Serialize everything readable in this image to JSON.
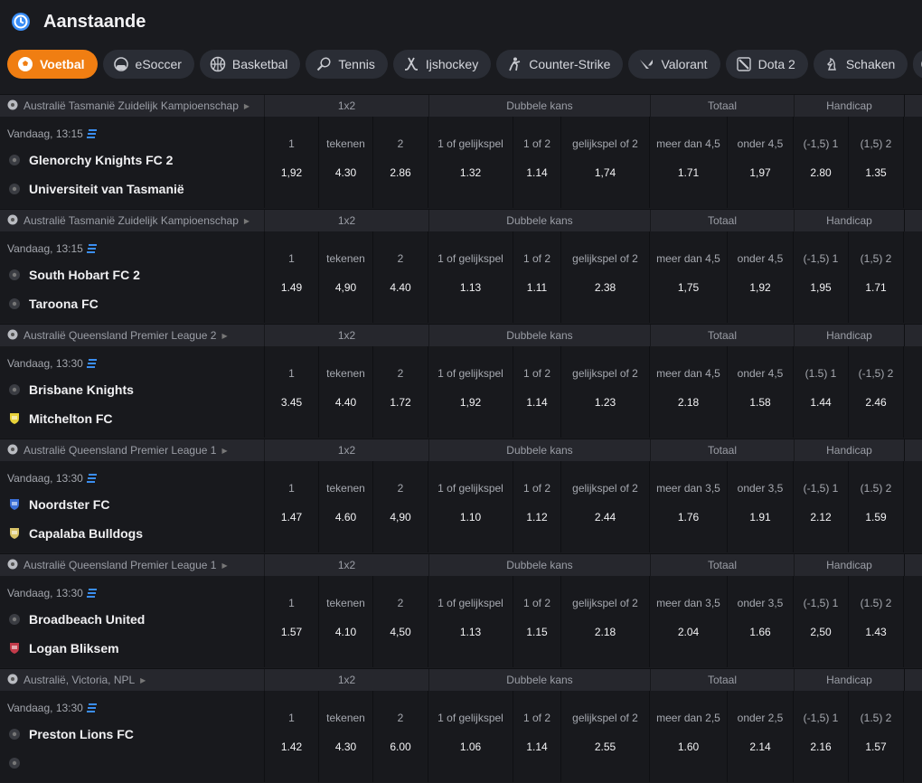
{
  "header": {
    "title": "Aanstaande"
  },
  "tabs": [
    {
      "label": "Voetbal",
      "icon": "soccer-ball-icon",
      "active": true
    },
    {
      "label": "eSoccer",
      "icon": "esoccer-icon"
    },
    {
      "label": "Basketbal",
      "icon": "basketball-icon"
    },
    {
      "label": "Tennis",
      "icon": "tennis-racket-icon"
    },
    {
      "label": "Ijshockey",
      "icon": "hockey-stick-icon"
    },
    {
      "label": "Counter-Strike",
      "icon": "counter-strike-icon"
    },
    {
      "label": "Valorant",
      "icon": "valorant-icon"
    },
    {
      "label": "Dota 2",
      "icon": "dota2-icon"
    },
    {
      "label": "Schaken",
      "icon": "chess-icon"
    },
    {
      "label": "",
      "icon": "more-sport-icon"
    }
  ],
  "groups": {
    "g1x2": "1x2",
    "dubbele": "Dubbele kans",
    "totaal": "Totaal",
    "handicap": "Handicap"
  },
  "events": [
    {
      "league": "Australië Tasmanië Zuidelijk Kampioenschap",
      "time": "Vandaag, 13:15",
      "team1": "Glenorchy Knights FC 2",
      "team2": "Universiteit van Tasmanië",
      "logo1": "#444",
      "logo2": "#444",
      "labels": [
        "1",
        "tekenen",
        "2",
        "1 of gelijkspel",
        "1 of 2",
        "gelijkspel of 2",
        "meer dan 4,5",
        "onder 4,5",
        "(-1,5)  1",
        "(1,5)  2"
      ],
      "odds": [
        "1,92",
        "4.30",
        "2.86",
        "1.32",
        "1.14",
        "1,74",
        "1.71",
        "1,97",
        "2.80",
        "1.35"
      ]
    },
    {
      "league": "Australië Tasmanië Zuidelijk Kampioenschap",
      "time": "Vandaag, 13:15",
      "team1": "South Hobart FC 2",
      "team2": "Taroona FC",
      "logo1": "#444",
      "logo2": "#444",
      "labels": [
        "1",
        "tekenen",
        "2",
        "1 of gelijkspel",
        "1 of 2",
        "gelijkspel of 2",
        "meer dan 4,5",
        "onder 4,5",
        "(-1,5)  1",
        "(1,5)  2"
      ],
      "odds": [
        "1.49",
        "4,90",
        "4.40",
        "1.13",
        "1.11",
        "2.38",
        "1,75",
        "1,92",
        "1,95",
        "1.71"
      ]
    },
    {
      "league": "Australië Queensland Premier League 2",
      "time": "Vandaag, 13:30",
      "team1": "Brisbane Knights",
      "team2": "Mitchelton FC",
      "logo1": "#444",
      "logo2": "#e8d23a",
      "labels": [
        "1",
        "tekenen",
        "2",
        "1 of gelijkspel",
        "1 of 2",
        "gelijkspel of 2",
        "meer dan 4,5",
        "onder 4,5",
        "(1.5)  1",
        "(-1,5)  2"
      ],
      "odds": [
        "3.45",
        "4.40",
        "1.72",
        "1,92",
        "1.14",
        "1.23",
        "2.18",
        "1.58",
        "1.44",
        "2.46"
      ]
    },
    {
      "league": "Australië Queensland Premier League 1",
      "time": "Vandaag, 13:30",
      "team1": "Noordster FC",
      "team2": "Capalaba Bulldogs",
      "logo1": "#3b6fd6",
      "logo2": "#d9c468",
      "labels": [
        "1",
        "tekenen",
        "2",
        "1 of gelijkspel",
        "1 of 2",
        "gelijkspel of 2",
        "meer dan 3,5",
        "onder 3,5",
        "(-1,5)  1",
        "(1.5)  2"
      ],
      "odds": [
        "1.47",
        "4.60",
        "4,90",
        "1.10",
        "1.12",
        "2.44",
        "1.76",
        "1.91",
        "2.12",
        "1.59"
      ]
    },
    {
      "league": "Australië Queensland Premier League 1",
      "time": "Vandaag, 13:30",
      "team1": "Broadbeach United",
      "team2": "Logan Bliksem",
      "logo1": "#444",
      "logo2": "#c33b4a",
      "labels": [
        "1",
        "tekenen",
        "2",
        "1 of gelijkspel",
        "1 of 2",
        "gelijkspel of 2",
        "meer dan 3,5",
        "onder 3,5",
        "(-1,5)  1",
        "(1.5)  2"
      ],
      "odds": [
        "1.57",
        "4.10",
        "4,50",
        "1.13",
        "1.15",
        "2.18",
        "2.04",
        "1.66",
        "2,50",
        "1.43"
      ]
    },
    {
      "league": "Australië, Victoria, NPL",
      "time": "Vandaag, 13:30",
      "team1": "Preston Lions FC",
      "team2": "",
      "logo1": "#444",
      "logo2": "#444",
      "labels": [
        "1",
        "tekenen",
        "2",
        "1 of gelijkspel",
        "1 of 2",
        "gelijkspel of 2",
        "meer dan 2,5",
        "onder 2,5",
        "(-1,5)  1",
        "(1.5)  2"
      ],
      "odds": [
        "1.42",
        "4.30",
        "6.00",
        "1.06",
        "1.14",
        "2.55",
        "1.60",
        "2.14",
        "2.16",
        "1.57"
      ]
    }
  ],
  "colors": {
    "accent": "#f07e12",
    "bg": "#1a1b1f",
    "row": "#18191d",
    "groupHeader": "#26272d",
    "stats": "#3b8ef0"
  }
}
